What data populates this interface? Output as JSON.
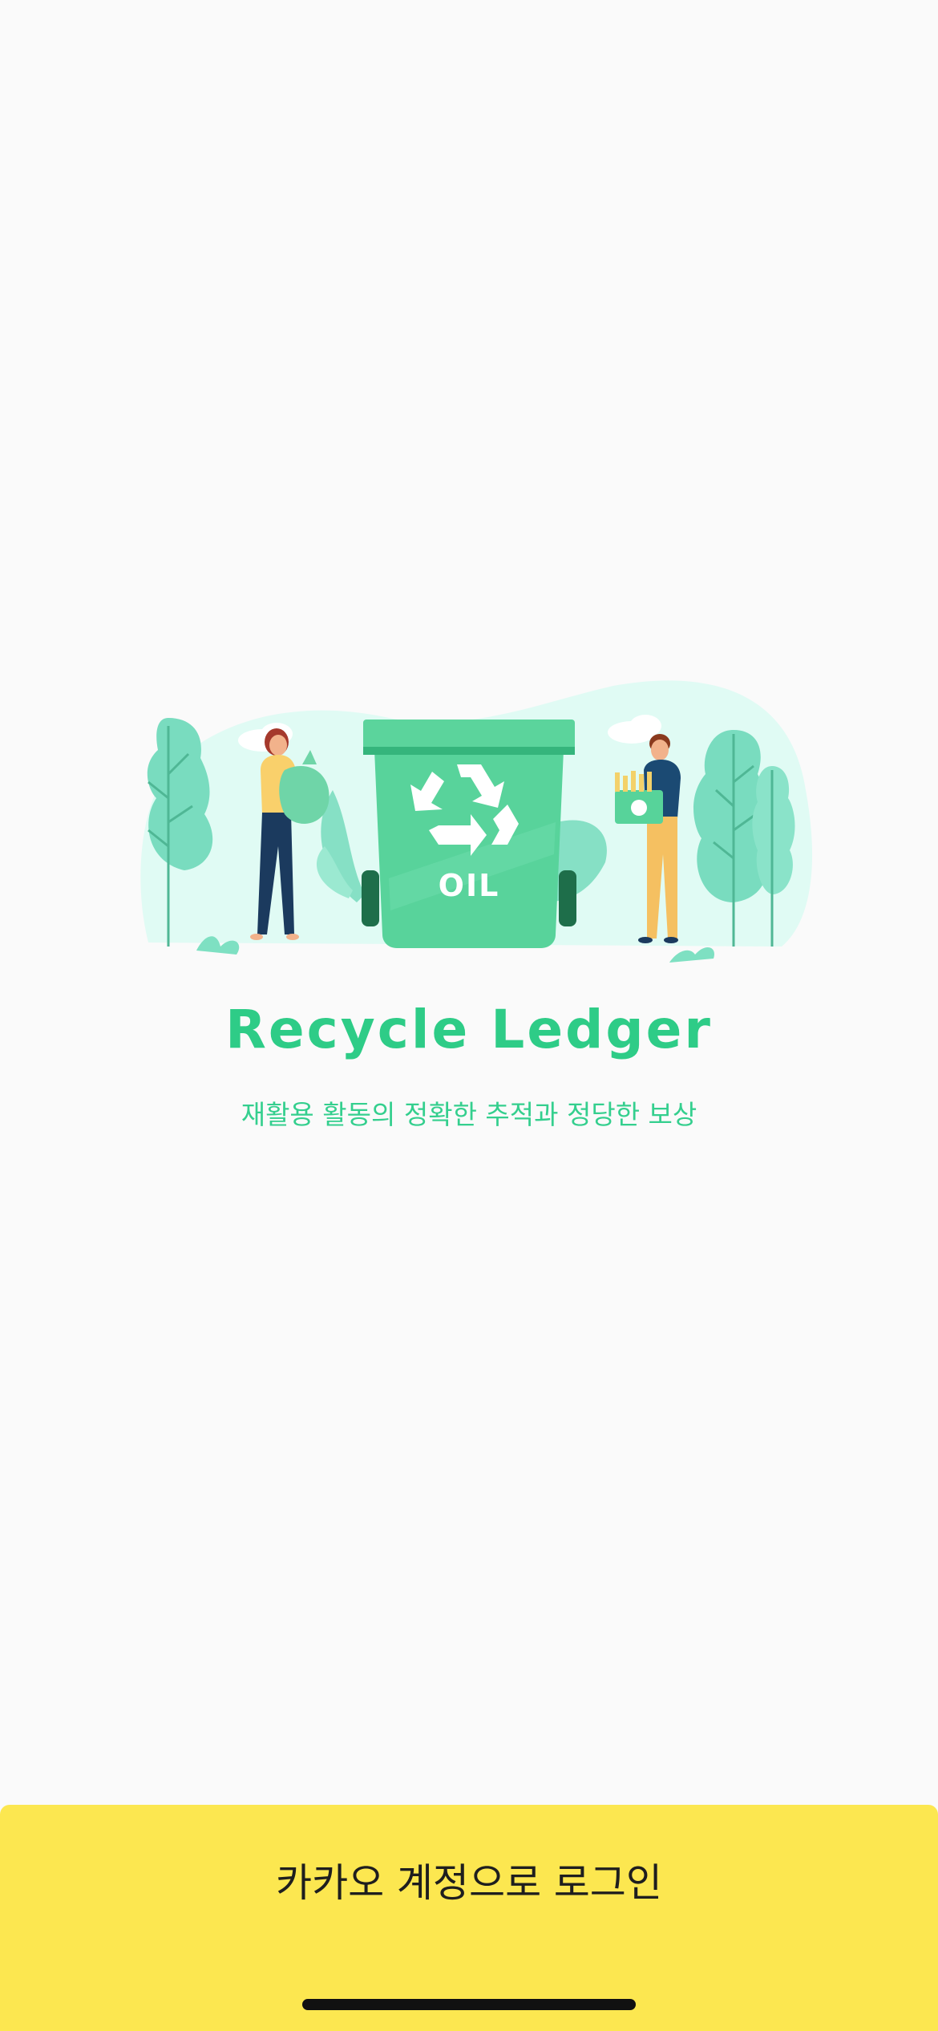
{
  "app": {
    "title": "Recycle Ledger",
    "tagline": "재활용 활동의 정확한 추적과 정당한 보상"
  },
  "illustration": {
    "bin_label": "OIL",
    "icons": [
      "recycle-icon"
    ]
  },
  "login": {
    "kakao_label": "카카오 계정으로 로그인"
  },
  "colors": {
    "background": "#fafafa",
    "brand_green": "#2ecc87",
    "kakao_yellow": "#fce750"
  }
}
